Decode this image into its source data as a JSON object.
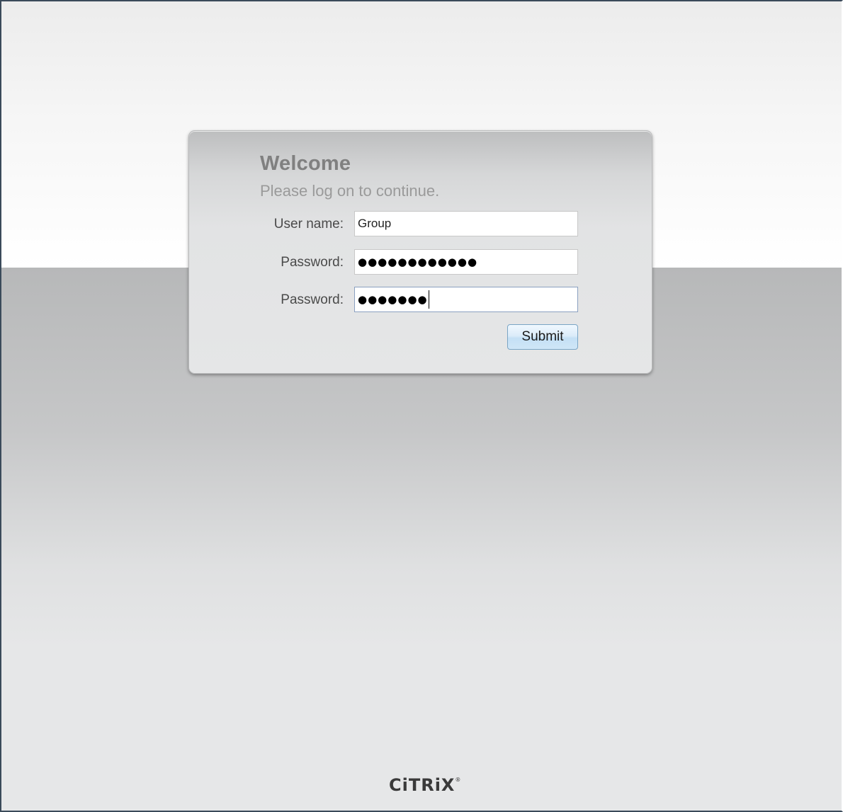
{
  "login": {
    "title": "Welcome",
    "subtitle": "Please log on to continue.",
    "username_label": "User name:",
    "username_value": "Group",
    "password1_label": "Password:",
    "password1_masked": "●●●●●●●●●●●●",
    "password2_label": "Password:",
    "password2_masked": "●●●●●●●",
    "submit_label": "Submit"
  },
  "brand": {
    "logo_text": "CiTRiX",
    "trademark": "®"
  },
  "colors": {
    "title": "#808080",
    "subtitle": "#9a9a9a",
    "button_border": "#7aa5c5",
    "bg_bottom": "#c6c7c8"
  }
}
